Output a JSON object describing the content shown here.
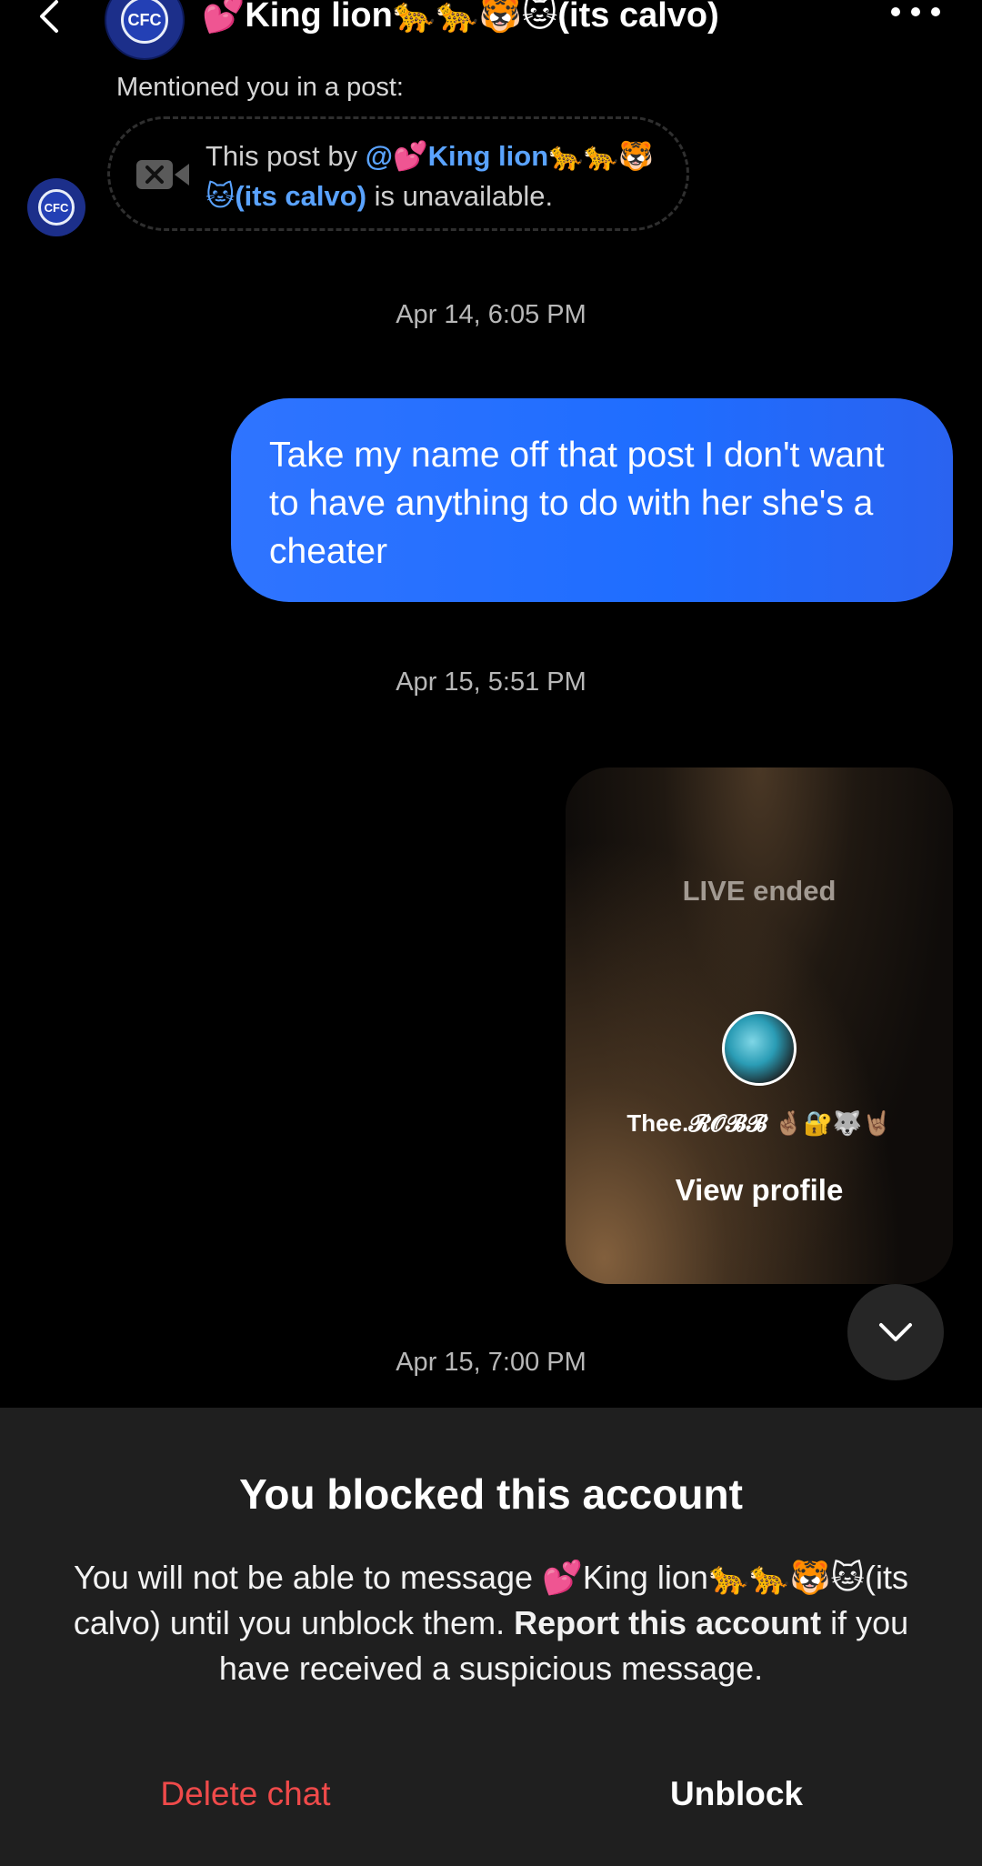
{
  "header": {
    "title": "💕King lion🐆🐆🐯🐱(its calvo)",
    "avatar_text": "CFC"
  },
  "thread": {
    "mention_label": "Mentioned you in a post:",
    "unavailable_post": {
      "prefix": "This post by ",
      "author": "@💕King lion🐆🐆🐯🐱(its calvo)",
      "suffix": " is unavailable."
    },
    "timestamps": [
      "Apr 14, 6:05 PM",
      "Apr 15, 5:51 PM",
      "Apr 15, 7:00 PM"
    ],
    "sent_message": "Take my name off that post I don't want to have anything to do with her she's a cheater",
    "live_card": {
      "status": "LIVE ended",
      "username": "Thee.𝓡𝓞𝓑𝓑 🤞🏽🔐🐺🤘🏽",
      "view_profile": "View profile"
    }
  },
  "blocked_panel": {
    "title": "You blocked this account",
    "body_part1": "You will not be able to message 💕King lion🐆🐆🐯🐱(its calvo) until you unblock them. ",
    "body_bold": "Report this account",
    "body_part2": " if you have received a suspicious message.",
    "delete_label": "Delete chat",
    "unblock_label": "Unblock"
  },
  "colors": {
    "background": "#000000",
    "sent_bubble": "#2f74ff",
    "link": "#5aa3ff",
    "danger": "#ef4a4a",
    "panel": "#1f1f1f"
  },
  "icons": [
    "chevron-left-icon",
    "more-icon",
    "video-off-icon",
    "chevron-down-icon"
  ]
}
